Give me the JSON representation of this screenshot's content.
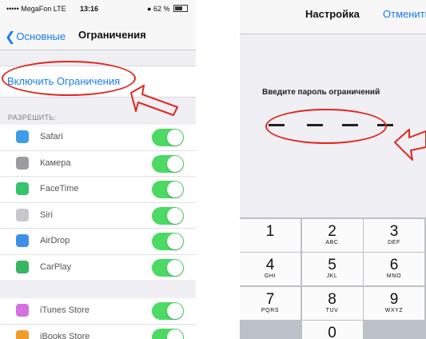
{
  "left": {
    "status": {
      "carrier": "••••• MegaFon  LTE",
      "time": "13:16",
      "battery": "62 %"
    },
    "nav": {
      "back_label": "Основные",
      "title": "Ограничения"
    },
    "enable_restrictions": "Включить Ограничения",
    "section_header": "РАЗРЕШИТЬ:",
    "items": [
      {
        "label": "Safari",
        "icon": "safari-icon",
        "color": "#3e9be8",
        "enabled": true
      },
      {
        "label": "Камера",
        "icon": "camera-icon",
        "color": "#9b9ba0",
        "enabled": true
      },
      {
        "label": "FaceTime",
        "icon": "facetime-icon",
        "color": "#36c36b",
        "enabled": true
      },
      {
        "label": "Siri",
        "icon": "siri-icon",
        "color": "#c7c7cc",
        "enabled": true
      },
      {
        "label": "AirDrop",
        "icon": "airdrop-icon",
        "color": "#3f8fe6",
        "enabled": true
      },
      {
        "label": "CarPlay",
        "icon": "carplay-icon",
        "color": "#38b560",
        "enabled": true
      }
    ],
    "items2": [
      {
        "label": "iTunes Store",
        "icon": "itunes-icon",
        "color": "#d570e0",
        "enabled": true
      },
      {
        "label": "iBooks Store",
        "icon": "ibooks-icon",
        "color": "#f29b2a",
        "enabled": true
      }
    ]
  },
  "right": {
    "nav": {
      "title": "Настройка",
      "cancel_label": "Отменить"
    },
    "prompt": "Введите пароль ограничений",
    "keys": [
      {
        "d": "1",
        "s": ""
      },
      {
        "d": "2",
        "s": "ABC"
      },
      {
        "d": "3",
        "s": "DEF"
      },
      {
        "d": "4",
        "s": "GHI"
      },
      {
        "d": "5",
        "s": "JKL"
      },
      {
        "d": "6",
        "s": "MNO"
      },
      {
        "d": "7",
        "s": "PQRS"
      },
      {
        "d": "8",
        "s": "TUV"
      },
      {
        "d": "9",
        "s": "WXYZ"
      },
      {
        "d": "",
        "s": ""
      },
      {
        "d": "0",
        "s": ""
      },
      {
        "d": "",
        "s": ""
      }
    ]
  },
  "colors": {
    "accent": "#1a7cf0",
    "annotation": "#e2261f",
    "toggle_on": "#4cd964"
  }
}
